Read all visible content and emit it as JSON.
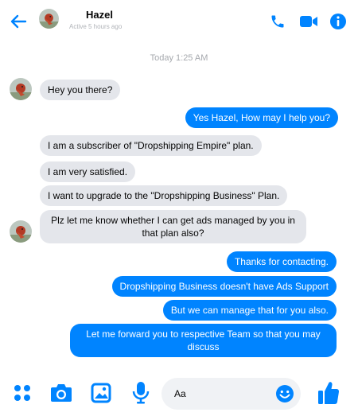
{
  "header": {
    "name": "Hazel",
    "status": "Active 5 hours ago"
  },
  "timestamp": "Today 1:25 AM",
  "messages": [
    {
      "from": "contact",
      "text": "Hey you there?"
    },
    {
      "from": "me",
      "text": "Yes Hazel, How may I help you?"
    },
    {
      "from": "contact",
      "text": "I am a subscriber of \"Dropshipping Empire\" plan."
    },
    {
      "from": "contact",
      "text": "I am very satisfied."
    },
    {
      "from": "contact",
      "text": "I want to upgrade to the \"Dropshipping Business\" Plan."
    },
    {
      "from": "contact",
      "text": "Plz let me know whether I can get ads managed by you in that plan also?"
    },
    {
      "from": "me",
      "text": "Thanks for contacting."
    },
    {
      "from": "me",
      "text": "Dropshipping Business doesn't have Ads Support"
    },
    {
      "from": "me",
      "text": "But we can manage that for you also."
    },
    {
      "from": "me",
      "text": "Let me forward you to respective Team so that you may discuss"
    }
  ],
  "composer": {
    "placeholder": "Aa"
  },
  "colors": {
    "accent": "#0084ff",
    "incoming_bubble": "#e4e6eb"
  }
}
